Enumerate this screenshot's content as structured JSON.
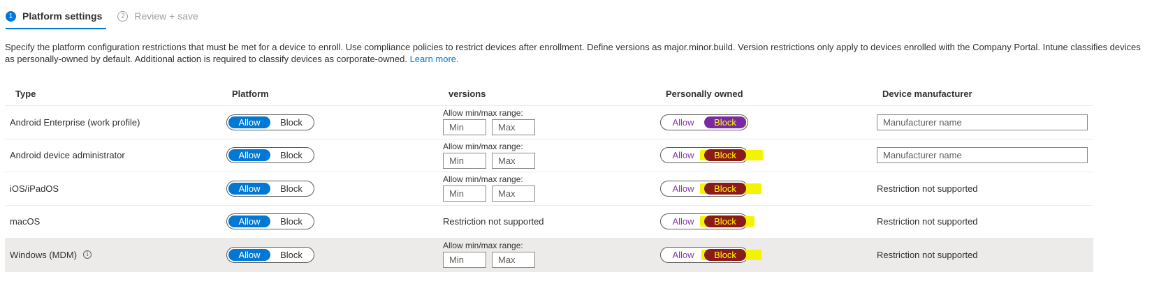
{
  "wizard": {
    "steps": [
      {
        "num": "1",
        "label": "Platform settings"
      },
      {
        "num": "2",
        "label": "Review + save"
      }
    ]
  },
  "description": {
    "text": "Specify the platform configuration restrictions that must be met for a device to enroll. Use compliance policies to restrict devices after enrollment. Define versions as major.minor.build. Version restrictions only apply to devices enrolled with the Company Portal. Intune classifies devices as personally-owned by default. Additional action is required to classify devices as corporate-owned.",
    "link": "Learn more."
  },
  "table": {
    "headers": {
      "type": "Type",
      "platform": "Platform",
      "versions": "versions",
      "owned": "Personally owned",
      "manufacturer": "Device manufacturer"
    },
    "toggle_labels": {
      "allow": "Allow",
      "block": "Block"
    },
    "range_label": "Allow min/max range:",
    "min_placeholder": "Min",
    "max_placeholder": "Max",
    "manufacturer_placeholder": "Manufacturer name",
    "not_supported": "Restriction not supported",
    "rows": [
      {
        "type": "Android Enterprise (work profile)"
      },
      {
        "type": "Android device administrator"
      },
      {
        "type": "iOS/iPadOS"
      },
      {
        "type": "macOS"
      },
      {
        "type": "Windows (MDM)"
      }
    ]
  },
  "colors": {
    "accent": "#0078d4",
    "highlight": "#f4f400",
    "block_selected": "#8b1a1a"
  }
}
